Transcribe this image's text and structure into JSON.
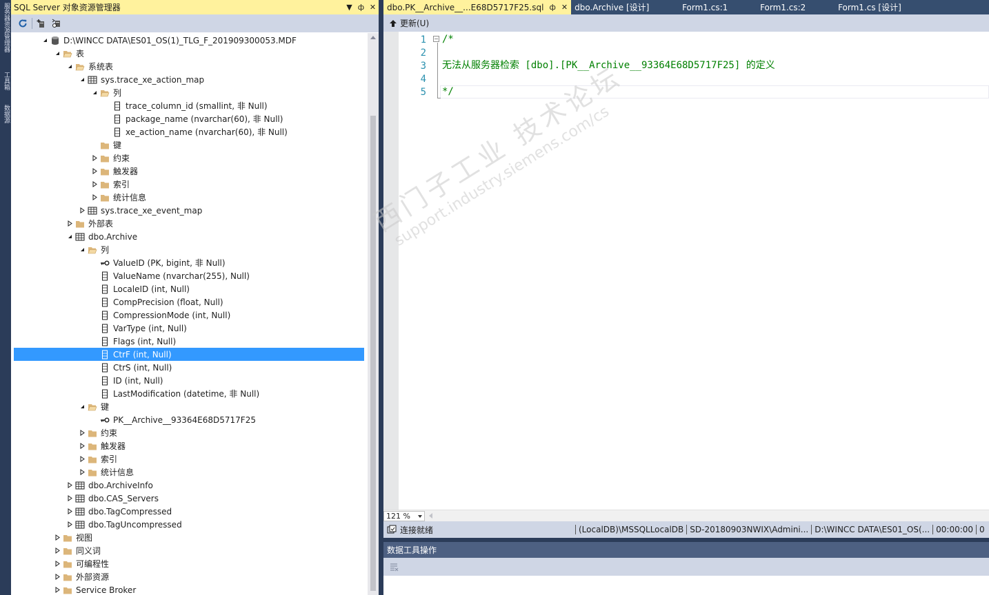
{
  "left_rail": {
    "tabs": [
      "服务器资源管理器",
      "工具箱",
      "数据源"
    ]
  },
  "object_explorer": {
    "title": "SQL Server 对象资源管理器",
    "title_buttons": {
      "dropdown": "▼",
      "pin": "ф",
      "close": "✕"
    },
    "tree": [
      {
        "level": 3,
        "exp": "expanded",
        "icon": "database-icon",
        "label": "D:\\WINCC DATA\\ES01_OS(1)_TLG_F_201909300053.MDF"
      },
      {
        "level": 4,
        "exp": "expanded",
        "icon": "folder-open-icon",
        "label": "表"
      },
      {
        "level": 5,
        "exp": "expanded",
        "icon": "folder-open-icon",
        "label": "系统表"
      },
      {
        "level": 6,
        "exp": "expanded",
        "icon": "table-icon",
        "label": "sys.trace_xe_action_map"
      },
      {
        "level": 7,
        "exp": "expanded",
        "icon": "folder-open-icon",
        "label": "列"
      },
      {
        "level": 8,
        "exp": "none",
        "icon": "column-icon",
        "label": "trace_column_id (smallint, 非 Null)"
      },
      {
        "level": 8,
        "exp": "none",
        "icon": "column-icon",
        "label": "package_name (nvarchar(60), 非 Null)"
      },
      {
        "level": 8,
        "exp": "none",
        "icon": "column-icon",
        "label": "xe_action_name (nvarchar(60), 非 Null)"
      },
      {
        "level": 7,
        "exp": "none",
        "icon": "folder-icon",
        "label": "键"
      },
      {
        "level": 7,
        "exp": "collapsed",
        "icon": "folder-icon",
        "label": "约束"
      },
      {
        "level": 7,
        "exp": "collapsed",
        "icon": "folder-icon",
        "label": "触发器"
      },
      {
        "level": 7,
        "exp": "collapsed",
        "icon": "folder-icon",
        "label": "索引"
      },
      {
        "level": 7,
        "exp": "collapsed",
        "icon": "folder-icon",
        "label": "统计信息"
      },
      {
        "level": 6,
        "exp": "collapsed",
        "icon": "table-icon",
        "label": "sys.trace_xe_event_map"
      },
      {
        "level": 5,
        "exp": "collapsed",
        "icon": "folder-icon",
        "label": "外部表"
      },
      {
        "level": 5,
        "exp": "expanded",
        "icon": "table-icon",
        "label": "dbo.Archive"
      },
      {
        "level": 6,
        "exp": "expanded",
        "icon": "folder-open-icon",
        "label": "列"
      },
      {
        "level": 7,
        "exp": "none",
        "icon": "key-icon",
        "label": "ValueID (PK, bigint, 非 Null)"
      },
      {
        "level": 7,
        "exp": "none",
        "icon": "column-icon",
        "label": "ValueName (nvarchar(255), Null)"
      },
      {
        "level": 7,
        "exp": "none",
        "icon": "column-icon",
        "label": "LocaleID (int, Null)"
      },
      {
        "level": 7,
        "exp": "none",
        "icon": "column-icon",
        "label": "CompPrecision (float, Null)"
      },
      {
        "level": 7,
        "exp": "none",
        "icon": "column-icon",
        "label": "CompressionMode (int, Null)"
      },
      {
        "level": 7,
        "exp": "none",
        "icon": "column-icon",
        "label": "VarType (int, Null)"
      },
      {
        "level": 7,
        "exp": "none",
        "icon": "column-icon",
        "label": "Flags (int, Null)"
      },
      {
        "level": 7,
        "exp": "none",
        "icon": "column-icon",
        "label": "CtrF (int, Null)",
        "selected": true
      },
      {
        "level": 7,
        "exp": "none",
        "icon": "column-icon",
        "label": "CtrS (int, Null)"
      },
      {
        "level": 7,
        "exp": "none",
        "icon": "column-icon",
        "label": "ID (int, Null)"
      },
      {
        "level": 7,
        "exp": "none",
        "icon": "column-icon",
        "label": "LastModification (datetime, 非 Null)"
      },
      {
        "level": 6,
        "exp": "expanded",
        "icon": "folder-open-icon",
        "label": "键"
      },
      {
        "level": 7,
        "exp": "none",
        "icon": "key-icon",
        "label": "PK__Archive__93364E68D5717F25"
      },
      {
        "level": 6,
        "exp": "collapsed",
        "icon": "folder-icon",
        "label": "约束"
      },
      {
        "level": 6,
        "exp": "collapsed",
        "icon": "folder-icon",
        "label": "触发器"
      },
      {
        "level": 6,
        "exp": "collapsed",
        "icon": "folder-icon",
        "label": "索引"
      },
      {
        "level": 6,
        "exp": "collapsed",
        "icon": "folder-icon",
        "label": "统计信息"
      },
      {
        "level": 5,
        "exp": "collapsed",
        "icon": "table-icon",
        "label": "dbo.ArchiveInfo"
      },
      {
        "level": 5,
        "exp": "collapsed",
        "icon": "table-icon",
        "label": "dbo.CAS_Servers"
      },
      {
        "level": 5,
        "exp": "collapsed",
        "icon": "table-icon",
        "label": "dbo.TagCompressed"
      },
      {
        "level": 5,
        "exp": "collapsed",
        "icon": "table-icon",
        "label": "dbo.TagUncompressed"
      },
      {
        "level": 4,
        "exp": "collapsed",
        "icon": "folder-icon",
        "label": "视图"
      },
      {
        "level": 4,
        "exp": "collapsed",
        "icon": "folder-icon",
        "label": "同义词"
      },
      {
        "level": 4,
        "exp": "collapsed",
        "icon": "folder-icon",
        "label": "可编程性"
      },
      {
        "level": 4,
        "exp": "collapsed",
        "icon": "folder-icon",
        "label": "外部资源"
      },
      {
        "level": 4,
        "exp": "collapsed",
        "icon": "folder-icon",
        "label": "Service Broker"
      }
    ]
  },
  "doc_tabs": [
    {
      "label": "dbo.PK__Archive__...E68D5717F25.sql",
      "active": true,
      "pin": "ф",
      "close": "✕"
    },
    {
      "label": "dbo.Archive [设计]",
      "active": false
    },
    {
      "label": "Form1.cs:1",
      "active": false
    },
    {
      "label": "Form1.cs:2",
      "active": false
    },
    {
      "label": "Form1.cs [设计]",
      "active": false
    }
  ],
  "editor_toolbar": {
    "update_label": "更新(U)"
  },
  "editor": {
    "lines": [
      {
        "n": "1",
        "text": "/*"
      },
      {
        "n": "2",
        "text": ""
      },
      {
        "n": "3",
        "text": "无法从服务器检索 [dbo].[PK__Archive__93364E68D5717F25] 的定义"
      },
      {
        "n": "4",
        "text": ""
      },
      {
        "n": "5",
        "text": "*/"
      }
    ],
    "fold_glyph": "−"
  },
  "watermark": {
    "line1": "西门子工业 技术论坛",
    "line2": "support.industry.siemens.com/cs"
  },
  "zoom": {
    "value": "121 %"
  },
  "status_bar": {
    "state": "连接就绪",
    "segments": [
      "(LocalDB)\\MSSQLLocalDB",
      "SD-20180903NWIX\\Admini...",
      "D:\\WINCC DATA\\ES01_OS(...",
      "00:00:00",
      "0"
    ]
  },
  "data_tools": {
    "title": "数据工具操作"
  },
  "colors": {
    "active_title": "#fff29d",
    "selection": "#3399ff",
    "chrome": "#cfd6e5",
    "frame": "#2b3c59",
    "comment": "#008000",
    "line_number": "#2b91af"
  }
}
